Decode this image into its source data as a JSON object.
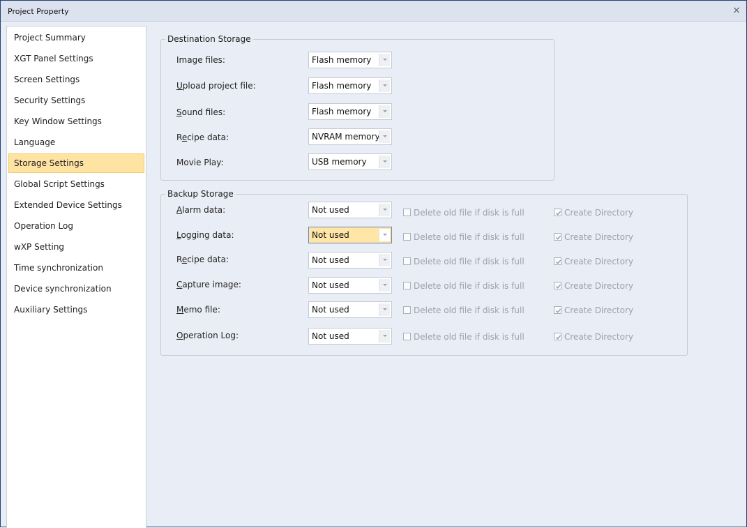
{
  "window": {
    "title": "Project Property",
    "close_symbol": "×"
  },
  "sidebar": {
    "items": [
      {
        "label": "Project Summary"
      },
      {
        "label": "XGT Panel Settings"
      },
      {
        "label": "Screen Settings"
      },
      {
        "label": "Security Settings"
      },
      {
        "label": "Key Window Settings"
      },
      {
        "label": "Language"
      },
      {
        "label": "Storage Settings",
        "active": true
      },
      {
        "label": "Global Script Settings"
      },
      {
        "label": "Extended Device Settings"
      },
      {
        "label": "Operation Log"
      },
      {
        "label": "wXP Setting"
      },
      {
        "label": "Time synchronization"
      },
      {
        "label": "Device synchronization"
      },
      {
        "label": "Auxiliary Settings"
      }
    ]
  },
  "destination": {
    "title": "Destination Storage",
    "rows": [
      {
        "key": "",
        "rest": "Image files:",
        "value": "Flash memory"
      },
      {
        "key": "U",
        "rest": "pload project file:",
        "value": "Flash memory"
      },
      {
        "key": "S",
        "rest": "ound files:",
        "value": "Flash memory"
      },
      {
        "pre": "R",
        "key": "e",
        "rest": "cipe data:",
        "value": "NVRAM memory"
      },
      {
        "key": "",
        "rest": "Movie Play:",
        "value": "USB memory"
      }
    ]
  },
  "backup": {
    "title": "Backup Storage",
    "delete_label": "Delete old file if disk is full",
    "directory_label": "Create Directory",
    "rows": [
      {
        "key": "A",
        "rest": "larm data:",
        "value": "Not used"
      },
      {
        "key": "L",
        "rest": "ogging data:",
        "value": "Not used"
      },
      {
        "pre": "R",
        "key": "e",
        "rest": "cipe data:",
        "value": "Not used"
      },
      {
        "key": "C",
        "rest": "apture image:",
        "value": "Not used"
      },
      {
        "key": "M",
        "rest": "emo file:",
        "value": "Not used"
      },
      {
        "key": "O",
        "rest": "peration Log:",
        "value": "Not used"
      }
    ]
  },
  "colors": {
    "accent": "#ffe3a3",
    "window_border": "#1f3f75"
  }
}
